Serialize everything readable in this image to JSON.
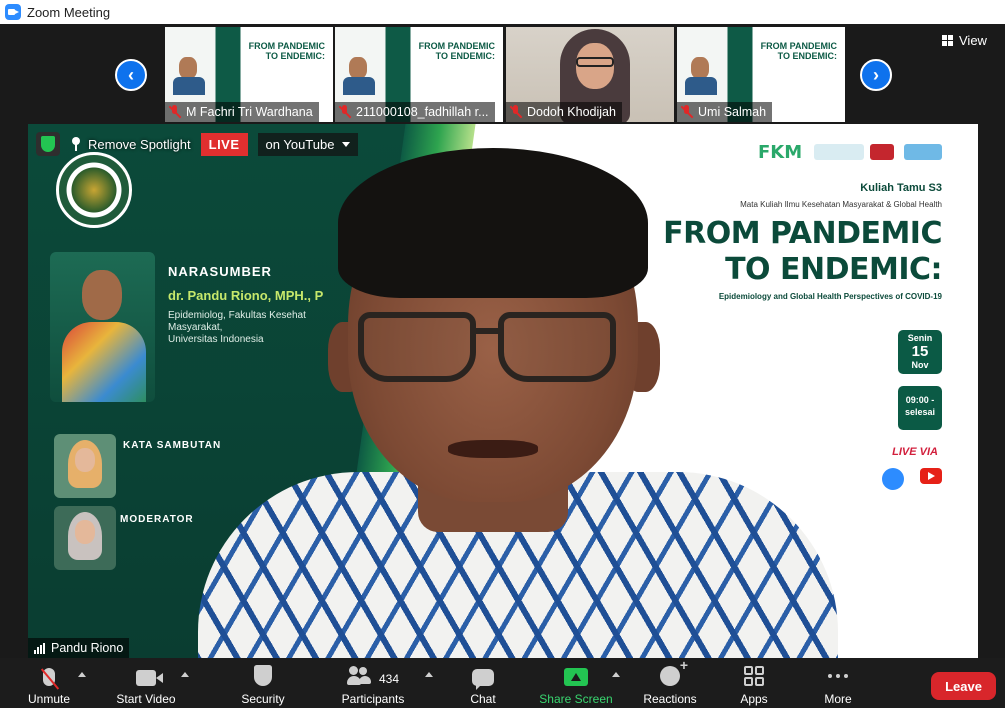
{
  "window": {
    "title": "Zoom Meeting"
  },
  "view_button": {
    "label": "View"
  },
  "thumbnails": [
    {
      "name": "M Fachri Tri Wardhana"
    },
    {
      "name": "211000108_fadhillah r..."
    },
    {
      "name": "Dodoh Khodijah"
    },
    {
      "name": "Umi Salmah"
    }
  ],
  "thumb_slide_title": "FROM PANDEMIC\nTO ENDEMIC:",
  "spotlight": {
    "remove_label": "Remove Spotlight",
    "live_badge": "LIVE",
    "live_target": "on YouTube",
    "speaker_name": "Pandu Riono"
  },
  "slide": {
    "narasumber_label": "NARASUMBER",
    "narasumber_name": "dr. Pandu Riono, MPH., P",
    "narasumber_desc": "Epidemiolog, Fakultas Kesehat\nMasyarakat,\nUniversitas Indonesia",
    "kata_sambutan": "KATA SAMBUTAN",
    "moderator": "MODERATOR",
    "fkm": "FKM",
    "kuliah": "Kuliah Tamu S3",
    "mata_kuliah": "Mata Kuliah Ilmu Kesehatan Masyarakat & Global Health",
    "title_line1": "FROM PANDEMIC",
    "title_line2": "TO ENDEMIC:",
    "subtitle": "Epidemiology and Global Health Perspectives of COVID-19",
    "day": "Senin",
    "date": "15",
    "month": "Nov",
    "time": "09:00 -",
    "time_end": "selesai",
    "live_via": "LIVE VIA"
  },
  "toolbar": {
    "unmute": "Unmute",
    "start_video": "Start Video",
    "security": "Security",
    "participants": "Participants",
    "participants_count": "434",
    "chat": "Chat",
    "share_screen": "Share Screen",
    "reactions": "Reactions",
    "apps": "Apps",
    "more": "More",
    "leave": "Leave"
  },
  "colors": {
    "accent_blue": "#0e72ed",
    "live_red": "#e02f2f",
    "leave_red": "#d8262b",
    "share_green": "#23c552",
    "slide_green": "#0b4a3a"
  }
}
